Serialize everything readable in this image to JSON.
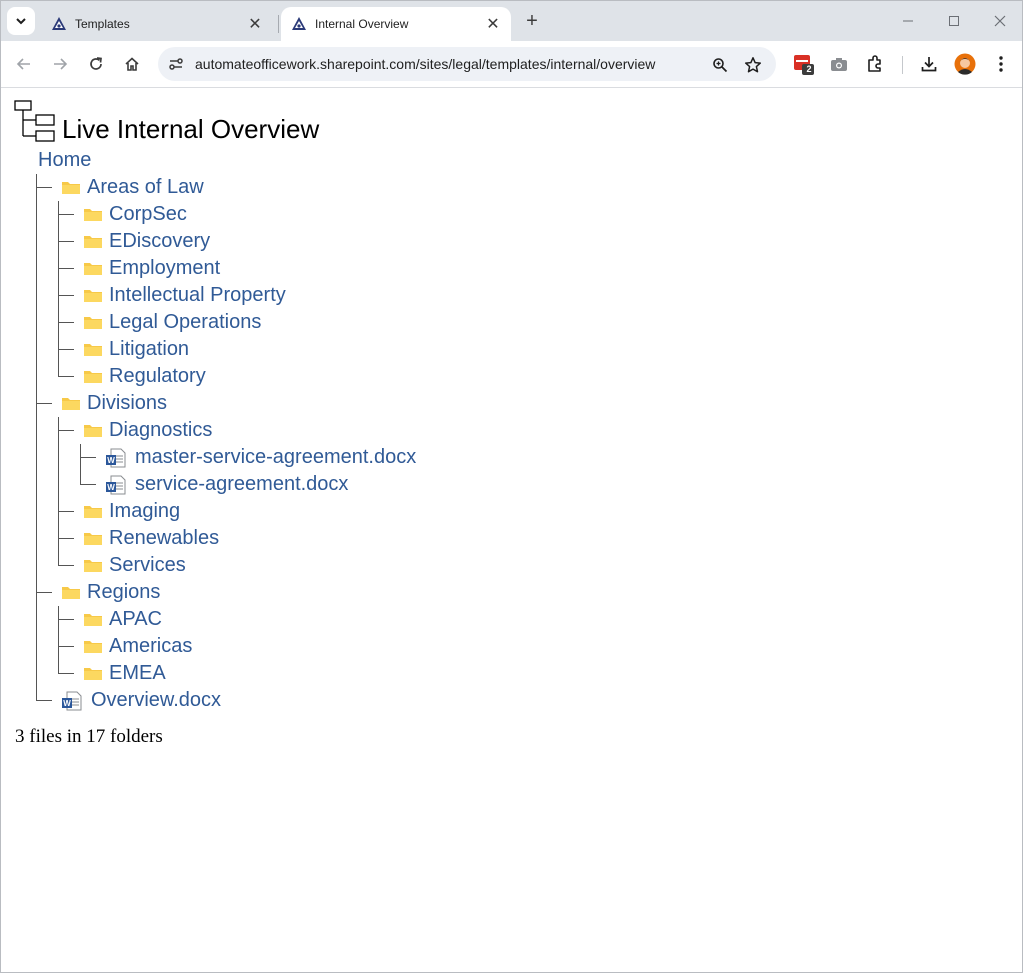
{
  "browser": {
    "tabs": [
      {
        "title": "Templates",
        "active": false
      },
      {
        "title": "Internal Overview",
        "active": true
      }
    ],
    "url": "automateofficework.sharepoint.com/sites/legal/templates/internal/overview",
    "extension_badge": "2"
  },
  "page": {
    "title": "Live Internal Overview",
    "home_label": "Home",
    "areas": {
      "label": "Areas of Law",
      "children": [
        "CorpSec",
        "EDiscovery",
        "Employment",
        "Intellectual Property",
        "Legal Operations",
        "Litigation",
        "Regulatory"
      ]
    },
    "divisions": {
      "label": "Divisions",
      "diagnostics": {
        "label": "Diagnostics",
        "files": [
          "master-service-agreement.docx",
          "service-agreement.docx"
        ]
      },
      "others": [
        "Imaging",
        "Renewables",
        "Services"
      ]
    },
    "regions": {
      "label": "Regions",
      "children": [
        "APAC",
        "Americas",
        "EMEA"
      ]
    },
    "root_file": "Overview.docx",
    "summary": "3 files in 17 folders"
  },
  "colors": {
    "link": "#305a96",
    "folder": "#f7c948",
    "tabstrip": "#dfe3e8",
    "omnibox": "#eef1f6"
  },
  "icons": [
    "tab-search-icon",
    "sharepoint-favicon-icon",
    "close-icon",
    "new-tab-icon",
    "minimize-icon",
    "maximize-icon",
    "window-close-icon",
    "back-icon",
    "forward-icon",
    "reload-icon",
    "home-icon",
    "site-info-icon",
    "zoom-icon",
    "bookmark-star-icon",
    "extension-calendar-icon",
    "camera-icon",
    "puzzle-icon",
    "download-icon",
    "avatar",
    "menu-icon",
    "tree-icon",
    "folder-icon",
    "word-doc-icon"
  ]
}
